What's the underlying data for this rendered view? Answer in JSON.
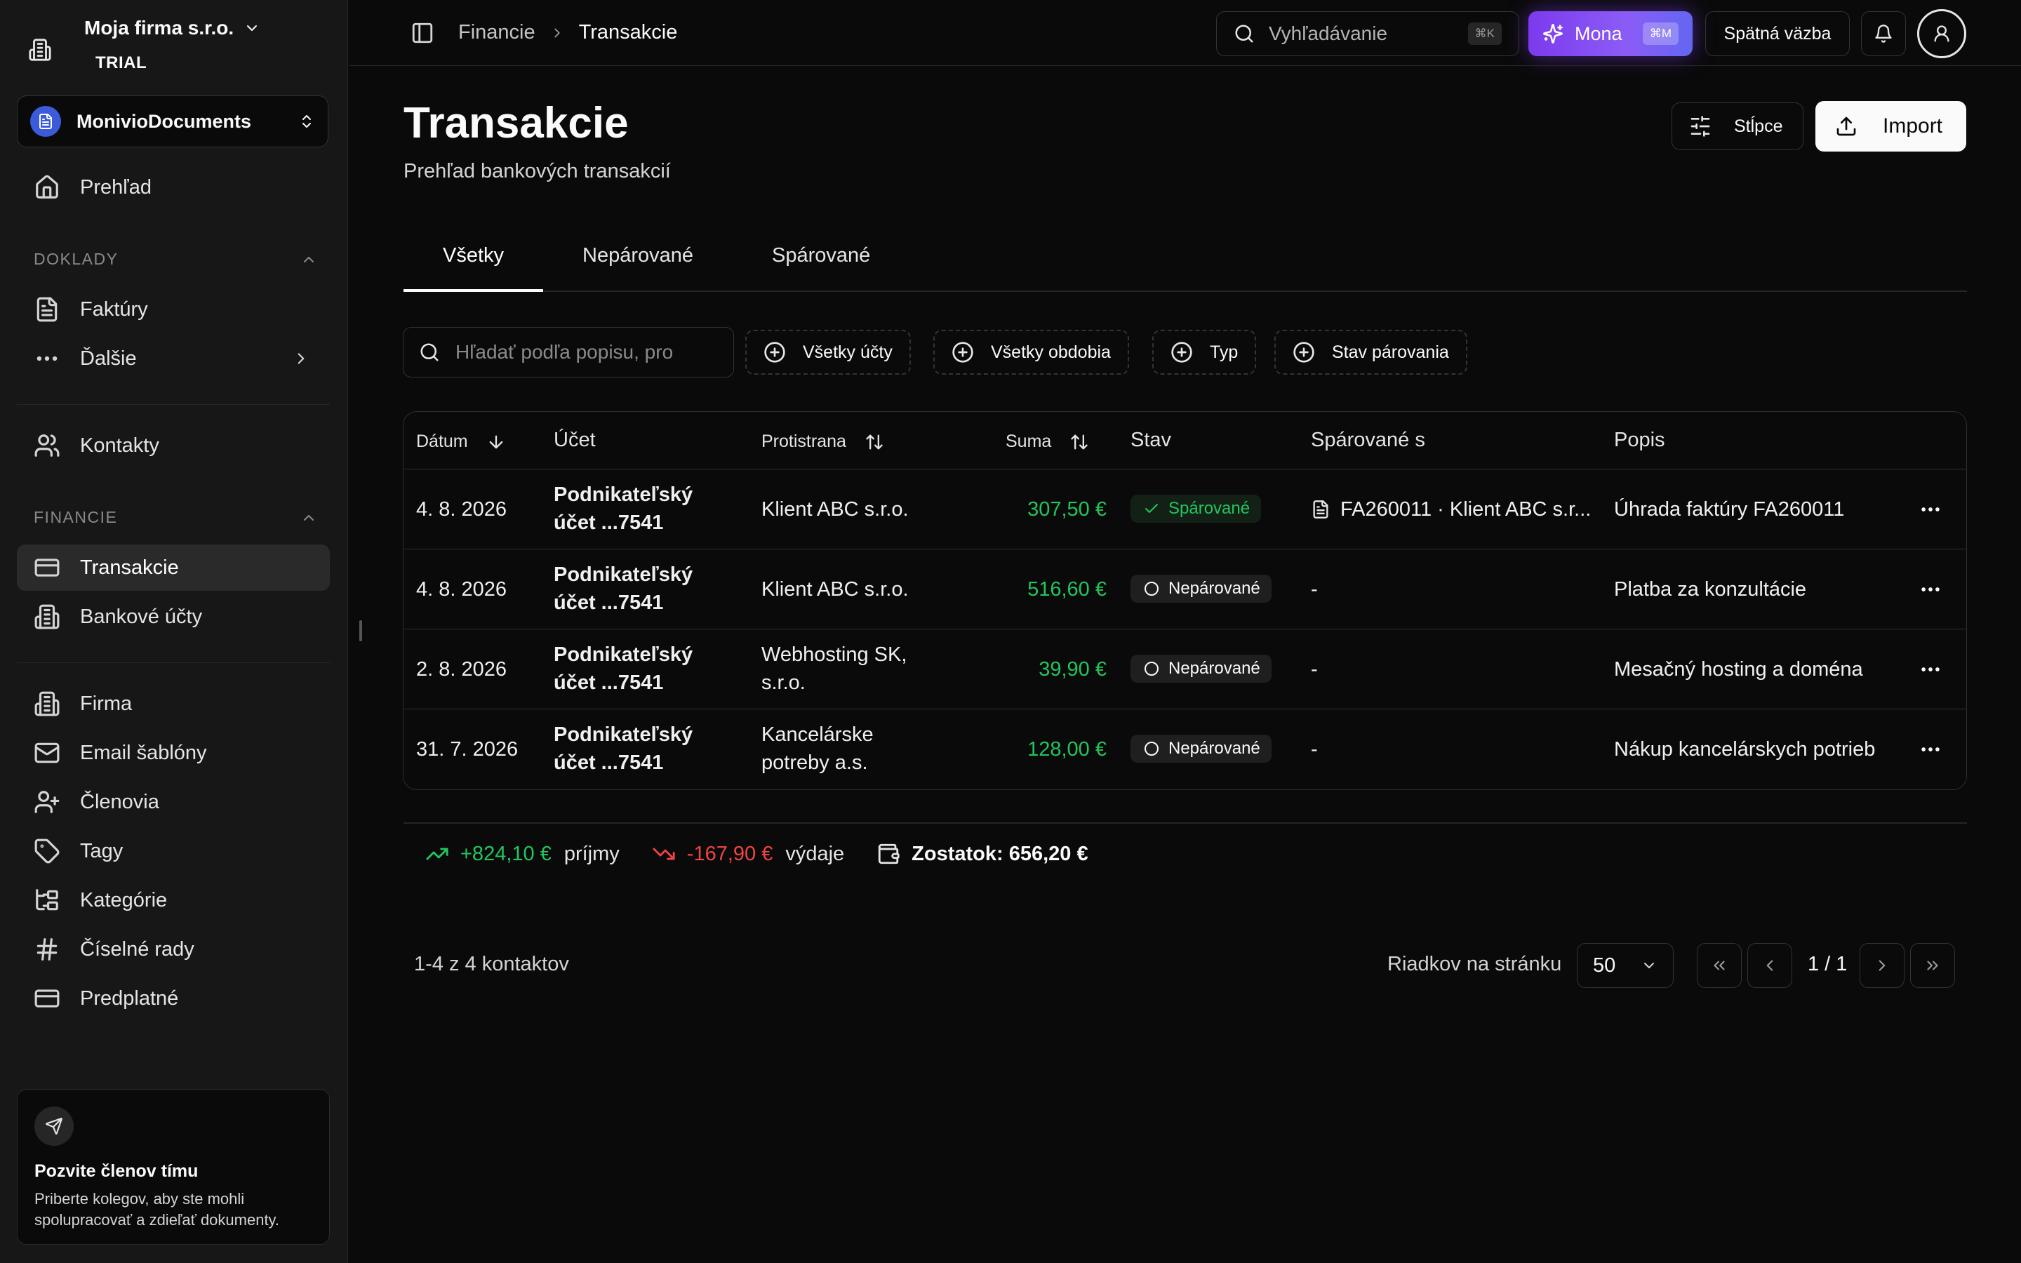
{
  "sidebar": {
    "company_name": "Moja firma s.r.o.",
    "plan": "TRIAL",
    "product": "MonivioDocuments",
    "overview": "Prehľad",
    "section_documents": "DOKLADY",
    "invoices": "Faktúry",
    "more": "Ďalšie",
    "contacts": "Kontakty",
    "section_finance": "FINANCIE",
    "transactions": "Transakcie",
    "bank_accounts": "Bankové účty",
    "company": "Firma",
    "email_templates": "Email šablóny",
    "members": "Členovia",
    "tags": "Tagy",
    "categories": "Kategórie",
    "number_series": "Číselné rady",
    "subscription": "Predplatné",
    "invite": {
      "title": "Pozvite členov tímu",
      "desc_line1": "Priberte kolegov, aby ste mohli",
      "desc_line2": "spolupracovať a zdieľať dokumenty."
    }
  },
  "topbar": {
    "breadcrumb_parent": "Financie",
    "breadcrumb_current": "Transakcie",
    "search_placeholder": "Vyhľadávanie",
    "search_kbd": "⌘K",
    "mona_label": "Mona",
    "mona_kbd": "⌘M",
    "feedback": "Spätná väzba"
  },
  "header": {
    "title": "Transakcie",
    "subtitle": "Prehľad bankových transakcií",
    "columns_button": "Stĺpce",
    "import_button": "Import"
  },
  "tabs": [
    "Všetky",
    "Nepárované",
    "Spárované"
  ],
  "filters": {
    "search_placeholder": "Hľadať podľa popisu, pro",
    "accounts": "Všetky účty",
    "periods": "Všetky obdobia",
    "type": "Typ",
    "pairing_status": "Stav párovania"
  },
  "table": {
    "headers": {
      "date": "Dátum",
      "account": "Účet",
      "counterparty": "Protistrana",
      "amount": "Suma",
      "status": "Stav",
      "matched_with": "Spárované s",
      "description": "Popis"
    },
    "rows": [
      {
        "date": "4. 8. 2026",
        "account1": "Podnikateľský",
        "account2": "účet ...7541",
        "cp1": "Klient ABC s.r.o.",
        "cp2": "",
        "amount": "307,50 €",
        "status": "Spárované",
        "matched": "FA260011 · Klient ABC s.r...",
        "desc": "Úhrada faktúry FA260011"
      },
      {
        "date": "4. 8. 2026",
        "account1": "Podnikateľský",
        "account2": "účet ...7541",
        "cp1": "Klient ABC s.r.o.",
        "cp2": "",
        "amount": "516,60 €",
        "status": "Nepárované",
        "matched": "-",
        "desc": "Platba za konzultácie"
      },
      {
        "date": "2. 8. 2026",
        "account1": "Podnikateľský",
        "account2": "účet ...7541",
        "cp1": "Webhosting SK,",
        "cp2": "s.r.o.",
        "amount": "39,90 €",
        "status": "Nepárované",
        "matched": "-",
        "desc": "Mesačný hosting a doména"
      },
      {
        "date": "31. 7. 2026",
        "account1": "Podnikateľský",
        "account2": "účet ...7541",
        "cp1": "Kancelárske",
        "cp2": "potreby a.s.",
        "amount": "128,00 €",
        "status": "Nepárované",
        "matched": "-",
        "desc": "Nákup kancelárskych potrieb"
      }
    ]
  },
  "summary": {
    "income": "+824,10 €",
    "income_label": "príjmy",
    "expense": "-167,90 €",
    "expense_label": "výdaje",
    "balance": "Zostatok: 656,20 €"
  },
  "pagination": {
    "count": "1-4 z 4 kontaktov",
    "rows_per_page_label": "Riadkov na stránku",
    "rows_per_page": "50",
    "page_info": "1 / 1"
  },
  "colors": {
    "accent_purple": "#7c3aed",
    "income": "#22c55e",
    "expense": "#ef4444"
  }
}
